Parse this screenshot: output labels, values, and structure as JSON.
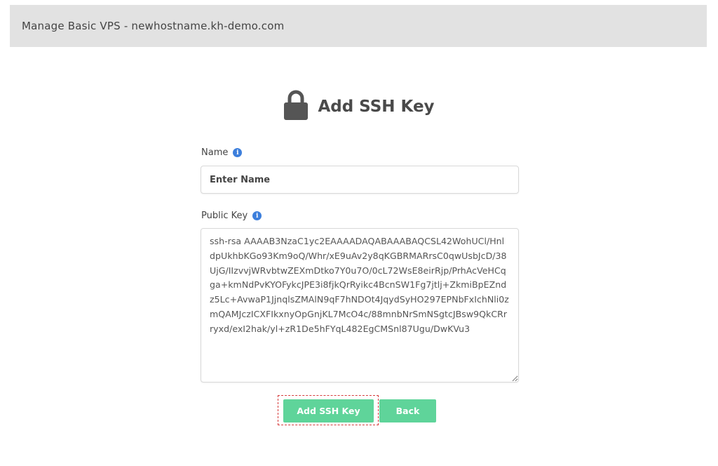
{
  "header": {
    "title": "Manage Basic VPS - newhostname.kh-demo.com"
  },
  "form": {
    "heading": "Add SSH Key",
    "heading_icon": "lock-icon",
    "name_label": "Name",
    "name_placeholder": "Enter Name",
    "public_key_label": "Public Key",
    "public_key_value": "ssh-rsa AAAAB3NzaC1yc2EAAAADAQABAAABAQCSL42WohUCl/HnldpUkhbKGo93Km9oQ/Whr/xE9uAv2y8qKGBRMARrsC0qwUsbJcD/38UjG/IIzvvjWRvbtwZEXmDtko7Y0u7O/0cL72WsE8eirRjp/PrhAcVeHCqga+kmNdPvKYOFykcJPE3i8fjkQrRyikc4BcnSW1Fg7jtlj+ZkmiBpEZndz5Lc+AvwaP1JjnqlsZMAlN9qF7hNDOt4JqydSyHO297EPNbFxIchNli0zmQAMJczICXFIkxnyOpGnjKL7McO4c/88mnbNrSmNSgtcJBsw9QkCRrryxd/exI2hak/yl+zR1De5hFYqL482EgCMSnl87Ugu/DwKVu3",
    "info_icon_glyph": "i"
  },
  "actions": {
    "add_label": "Add SSH Key",
    "back_label": "Back"
  },
  "colors": {
    "button": "#5fd49a",
    "info": "#3d7fdc",
    "highlight": "#d63c3c"
  }
}
